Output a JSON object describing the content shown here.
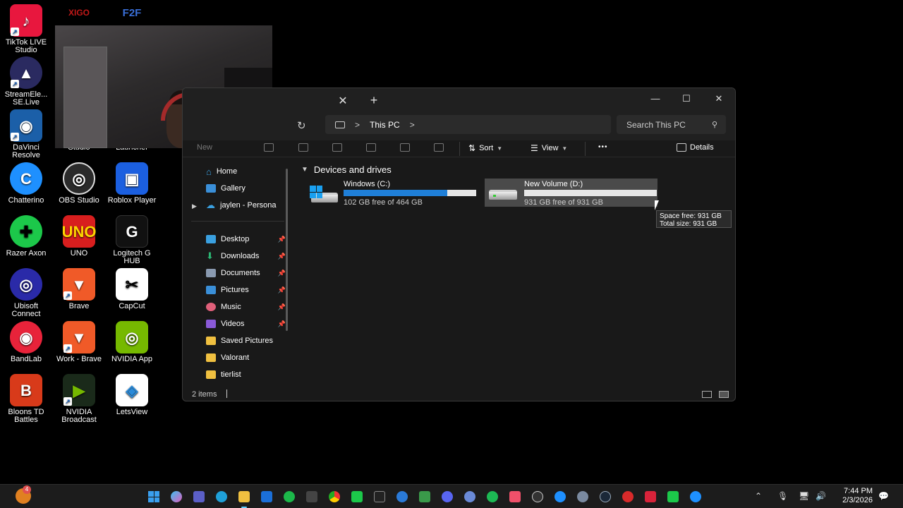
{
  "desktop": {
    "icons": [
      {
        "label": "TikTok LIVE Studio",
        "color": "#e8173e",
        "glyph": "♪"
      },
      {
        "label": "XIGO",
        "color": "#c01818",
        "glyph": "X"
      },
      {
        "label": "F2F",
        "color": "#3a6fd8",
        "glyph": "F"
      },
      {
        "label": "StreamEle... SE.Live",
        "color": "#2a2a60",
        "glyph": "▲"
      },
      {
        "label": "DaVinci Resolve",
        "color": "#1b5fa8",
        "glyph": "◉"
      },
      {
        "label": "Studio",
        "color": "#333333",
        "glyph": ""
      },
      {
        "label": "Launcher",
        "color": "#333333",
        "glyph": ""
      },
      {
        "label": "Chatterino",
        "color": "#1e90ff",
        "glyph": "C"
      },
      {
        "label": "OBS Studio",
        "color": "#2b2b2b",
        "glyph": "◎"
      },
      {
        "label": "Roblox Player",
        "color": "#1b5fe0",
        "glyph": "▣"
      },
      {
        "label": "Razer Axon",
        "color": "#1cc84a",
        "glyph": "✚"
      },
      {
        "label": "UNO",
        "color": "#d81e1e",
        "glyph": "U"
      },
      {
        "label": "Logitech G HUB",
        "color": "#111111",
        "glyph": "G"
      },
      {
        "label": "Ubisoft Connect",
        "color": "#2a2aa8",
        "glyph": "◎"
      },
      {
        "label": "Brave",
        "color": "#f05a28",
        "glyph": "▼"
      },
      {
        "label": "CapCut",
        "color": "#ffffff",
        "glyph": "✂"
      },
      {
        "label": "BandLab",
        "color": "#e8233a",
        "glyph": "◉"
      },
      {
        "label": "Work - Brave",
        "color": "#f05a28",
        "glyph": "▼"
      },
      {
        "label": "NVIDIA App",
        "color": "#76b900",
        "glyph": "◎"
      },
      {
        "label": "Bloons TD Battles",
        "color": "#d83a1a",
        "glyph": "B"
      },
      {
        "label": "NVIDIA Broadcast",
        "color": "#1a2a1a",
        "glyph": "▶"
      },
      {
        "label": "LetsView",
        "color": "#ffffff",
        "glyph": "◈"
      }
    ]
  },
  "window": {
    "tab_close": "✕",
    "tab_add": "+",
    "minimize": "—",
    "maximize": "☐",
    "close": "✕"
  },
  "address": {
    "refresh": "↻",
    "chevron": ">",
    "crumb": "This PC",
    "search_placeholder": "Search This PC"
  },
  "toolbar": {
    "new_label": "New",
    "sort_label": "Sort",
    "view_label": "View",
    "more_label": "•••",
    "details_label": "Details"
  },
  "sidebar": {
    "home": "Home",
    "gallery": "Gallery",
    "onedrive": "jaylen - Persona",
    "items": [
      {
        "label": "Desktop",
        "color": "#3aa0e0"
      },
      {
        "label": "Downloads",
        "color": "#2bb673"
      },
      {
        "label": "Documents",
        "color": "#8a9ab0"
      },
      {
        "label": "Pictures",
        "color": "#3a8fd8"
      },
      {
        "label": "Music",
        "color": "#e0607a"
      },
      {
        "label": "Videos",
        "color": "#8a5ad8"
      },
      {
        "label": "Saved Pictures",
        "color": "#f0c040"
      },
      {
        "label": "Valorant",
        "color": "#f0c040"
      },
      {
        "label": "tierlist",
        "color": "#f0c040"
      }
    ]
  },
  "content": {
    "group_title": "Devices and drives",
    "drives": [
      {
        "name": "Windows (C:)",
        "free_text": "102 GB free of 464 GB",
        "used_fraction": 0.78
      },
      {
        "name": "New Volume (D:)",
        "free_text": "931 GB free of 931 GB",
        "used_fraction": 0.0
      }
    ],
    "tooltip_free": "Space free: 931 GB",
    "tooltip_total": "Total size: 931 GB"
  },
  "status": {
    "items_count": "2 items"
  },
  "taskbar": {
    "weather_badge": "4",
    "time": "7:44 PM",
    "date": "2/3/2026"
  }
}
